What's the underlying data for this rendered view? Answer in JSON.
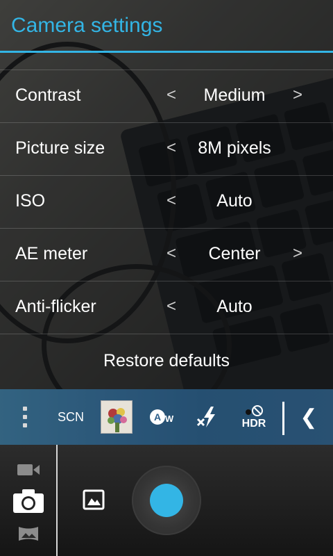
{
  "header": {
    "title": "Camera settings"
  },
  "settings": {
    "rows": [
      {
        "label": "Contrast",
        "value": "Medium",
        "prev": "<",
        "next": ">"
      },
      {
        "label": "Picture size",
        "value": "8M pixels",
        "prev": "<",
        "next": ""
      },
      {
        "label": "ISO",
        "value": "Auto",
        "prev": "<",
        "next": ""
      },
      {
        "label": "AE meter",
        "value": "Center",
        "prev": "<",
        "next": ">"
      },
      {
        "label": "Anti-flicker",
        "value": "Auto",
        "prev": "<",
        "next": ""
      }
    ],
    "restore_label": "Restore defaults"
  },
  "toolbar": {
    "scene_label": "SCN",
    "hdr_label": "HDR",
    "wb_label": "AW",
    "collapse_glyph": "❮",
    "icons": [
      "overflow-menu-icon",
      "scene-mode-icon",
      "color-effect-icon",
      "white-balance-icon",
      "flash-off-icon",
      "hdr-off-icon",
      "collapse-icon"
    ]
  },
  "controls": {
    "modes": [
      "video-mode-icon",
      "photo-mode-icon",
      "panorama-mode-icon"
    ],
    "selected_mode": "photo",
    "icons": [
      "gallery-icon",
      "shutter-button"
    ]
  },
  "colors": {
    "accent": "#33b5e5",
    "text": "#ffffff",
    "arrow": "#cfcfcf"
  }
}
